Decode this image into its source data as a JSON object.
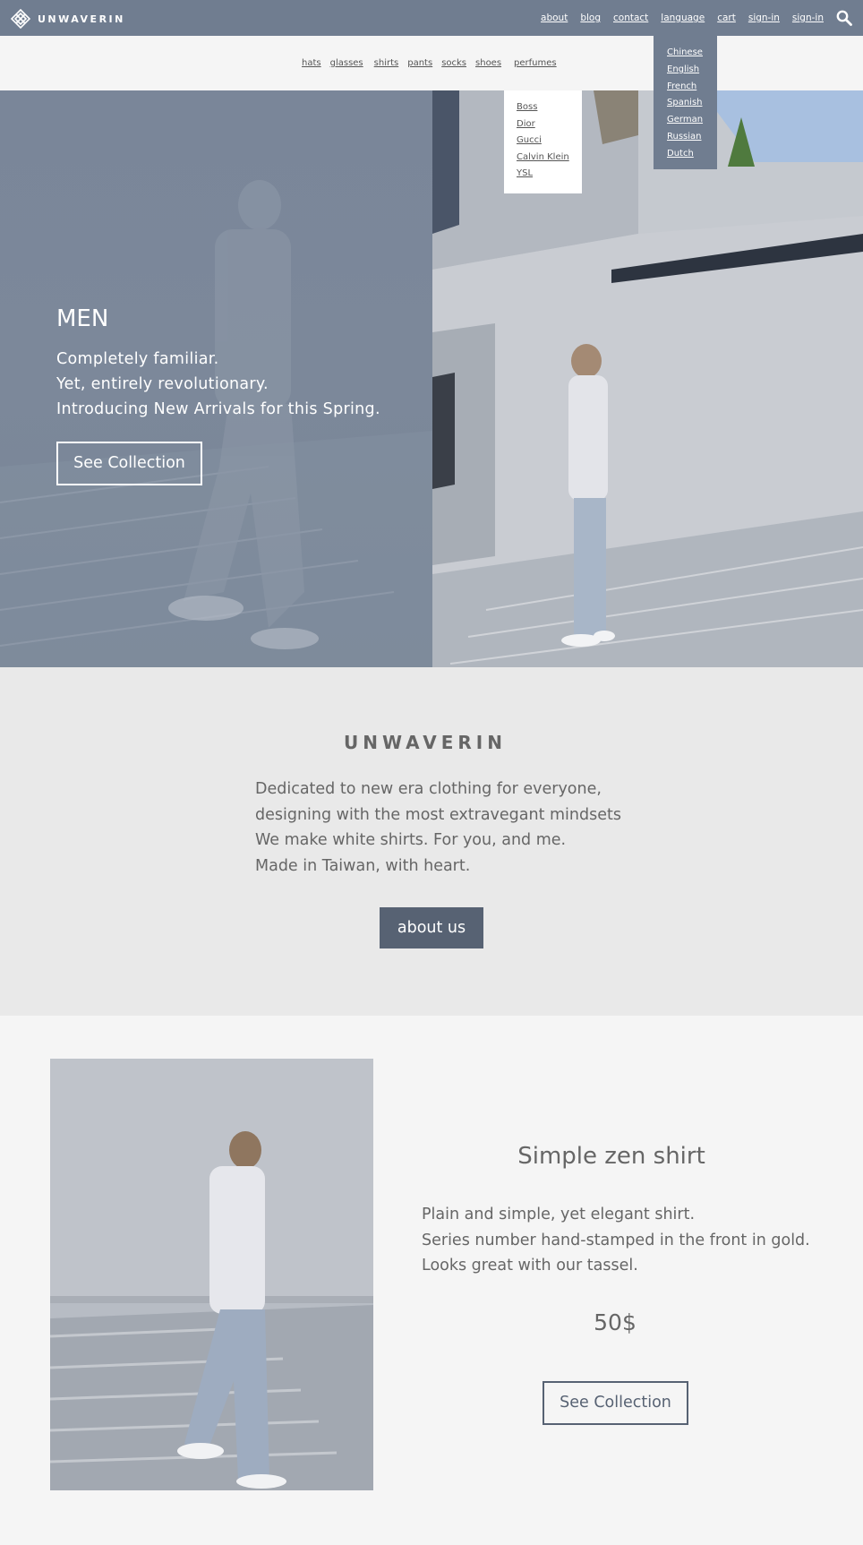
{
  "header": {
    "brand": "UNWAVERIN",
    "nav": [
      "about",
      "blog",
      "contact",
      "language",
      "cart",
      "sign-in",
      "sign-in"
    ]
  },
  "language_menu": [
    "Chinese",
    "English",
    "French",
    "Spanish",
    "German",
    "Russian",
    "Dutch"
  ],
  "subnav": [
    "hats",
    "glasses",
    "shirts",
    "pants",
    "socks",
    "shoes",
    "perfumes"
  ],
  "perfumes_menu": [
    "Boss",
    "Dior",
    "Gucci",
    "Calvin Klein",
    "YSL"
  ],
  "hero": {
    "title": "MEN",
    "lines": [
      "Completely familiar.",
      "Yet, entirely revolutionary.",
      "Introducing New Arrivals for this Spring."
    ],
    "button": "See Collection"
  },
  "about": {
    "brand": "UNWAVERIN",
    "lines": [
      "Dedicated to new era clothing for everyone,",
      "designing with the most extravegant mindsets",
      "We make white shirts. For you, and me.",
      "Made in Taiwan, with heart."
    ],
    "button": "about us"
  },
  "product": {
    "title": "Simple zen shirt",
    "lines": [
      "Plain and simple, yet elegant shirt.",
      "Series number hand-stamped in the front in gold.",
      "Looks great with our tassel."
    ],
    "price": "50$",
    "button": "See Collection"
  },
  "colors": {
    "header_bg": "#707d90",
    "hero_overlay": "#7a8699",
    "about_button": "#576273",
    "page_bg": "#f5f5f5",
    "about_bg": "#e9e9e9"
  }
}
